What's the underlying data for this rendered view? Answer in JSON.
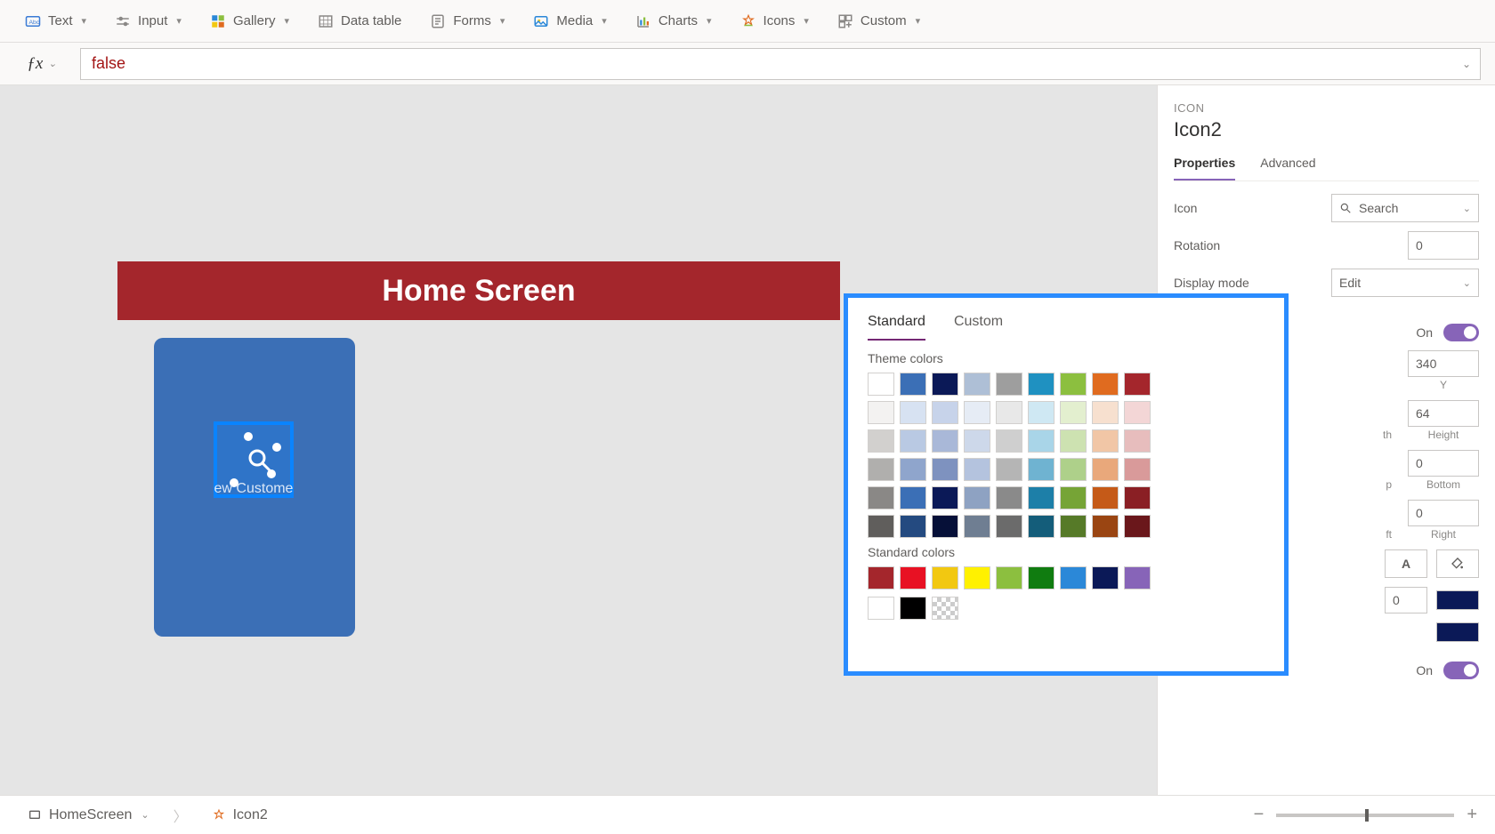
{
  "ribbon": {
    "text": "Text",
    "input": "Input",
    "gallery": "Gallery",
    "datatable": "Data table",
    "forms": "Forms",
    "media": "Media",
    "charts": "Charts",
    "icons": "Icons",
    "custom": "Custom"
  },
  "formula": {
    "value": "false"
  },
  "canvas": {
    "header_title": "Home Screen",
    "card_label": "ew Custome"
  },
  "panel": {
    "type_label": "ICON",
    "name": "Icon2",
    "tabs": {
      "properties": "Properties",
      "advanced": "Advanced"
    },
    "rows": {
      "icon_label": "Icon",
      "icon_value": "Search",
      "rotation_label": "Rotation",
      "rotation_value": "0",
      "displaymode_label": "Display mode",
      "displaymode_value": "Edit",
      "visible_on": "On",
      "y_label": "Y",
      "y_value": "340",
      "height_label": "Height",
      "height_value": "64",
      "top_label": "p",
      "bottom_label": "Bottom",
      "bottom_value": "0",
      "left_label": "ft",
      "right_label": "Right",
      "right_value": "0",
      "th_label": "th",
      "text_align_A": "A",
      "zero_value": "0",
      "toggle_on_label": "On"
    }
  },
  "color_picker": {
    "tab_standard": "Standard",
    "tab_custom": "Custom",
    "theme_title": "Theme colors",
    "standard_title": "Standard colors",
    "theme_rows": [
      [
        "#ffffff",
        "#3b6fb6",
        "#0b1957",
        "#aebfd6",
        "#9e9e9e",
        "#1f91c1",
        "#8cbf3f",
        "#e06b1f",
        "#a4262c"
      ],
      [
        "#f3f2f1",
        "#d7e2f2",
        "#c7d3ea",
        "#e6ecf5",
        "#e8e8e8",
        "#cfe8f3",
        "#e3efcf",
        "#f7e0cf",
        "#f3d6d6"
      ],
      [
        "#d2d0ce",
        "#b9c9e3",
        "#a9b8d8",
        "#cdd8ea",
        "#cfcfcf",
        "#a9d5e8",
        "#cde2b1",
        "#f1c6a6",
        "#e7bdbd"
      ],
      [
        "#b0afad",
        "#8fa5cc",
        "#7e92bf",
        "#b4c3de",
        "#b5b5b5",
        "#6fb3d1",
        "#aed08a",
        "#e9a87b",
        "#d99a9a"
      ],
      [
        "#8a8886",
        "#3b6fb6",
        "#0b1957",
        "#8ea2c2",
        "#8a8a8a",
        "#1d7fa8",
        "#76a436",
        "#c55a18",
        "#8a1f24"
      ],
      [
        "#605e5c",
        "#244a80",
        "#061038",
        "#6f7e92",
        "#6b6b6b",
        "#145d7a",
        "#567a28",
        "#9a4512",
        "#6a171b"
      ]
    ],
    "standard_row": [
      "#a4262c",
      "#e81123",
      "#f2c811",
      "#fff100",
      "#8cbf3f",
      "#107c10",
      "#2b88d8",
      "#0b1957",
      "#8764b8"
    ],
    "bw_row": [
      "#ffffff",
      "#000000",
      "transparent"
    ]
  },
  "status": {
    "screen": "HomeScreen",
    "element": "Icon2"
  }
}
